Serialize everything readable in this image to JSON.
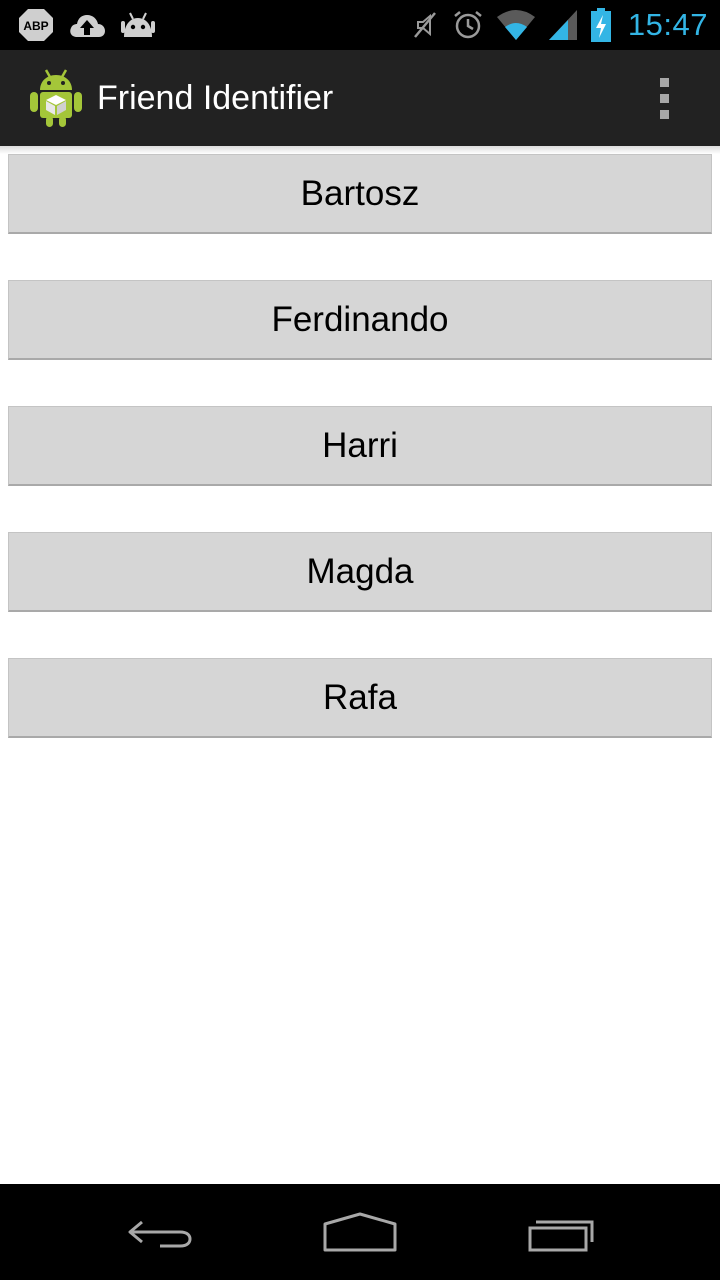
{
  "status_bar": {
    "notification_icons": [
      "adblock-plus-icon",
      "cloud-upload-icon",
      "android-robot-icon"
    ],
    "abp_label": "ABP",
    "system_icons": [
      "mute-icon",
      "alarm-icon",
      "wifi-icon",
      "signal-icon",
      "battery-charging-icon"
    ],
    "clock": "15:47",
    "clock_color": "#33b5e5"
  },
  "action_bar": {
    "app_icon": "android-app-icon",
    "title": "Friend Identifier",
    "overflow_icon": "overflow-menu-icon",
    "background": "#222222"
  },
  "friends": [
    {
      "name": "Bartosz"
    },
    {
      "name": "Ferdinando"
    },
    {
      "name": "Harri"
    },
    {
      "name": "Magda"
    },
    {
      "name": "Rafa"
    }
  ],
  "nav_bar": {
    "icons": [
      "back-icon",
      "home-icon",
      "recent-apps-icon"
    ]
  }
}
